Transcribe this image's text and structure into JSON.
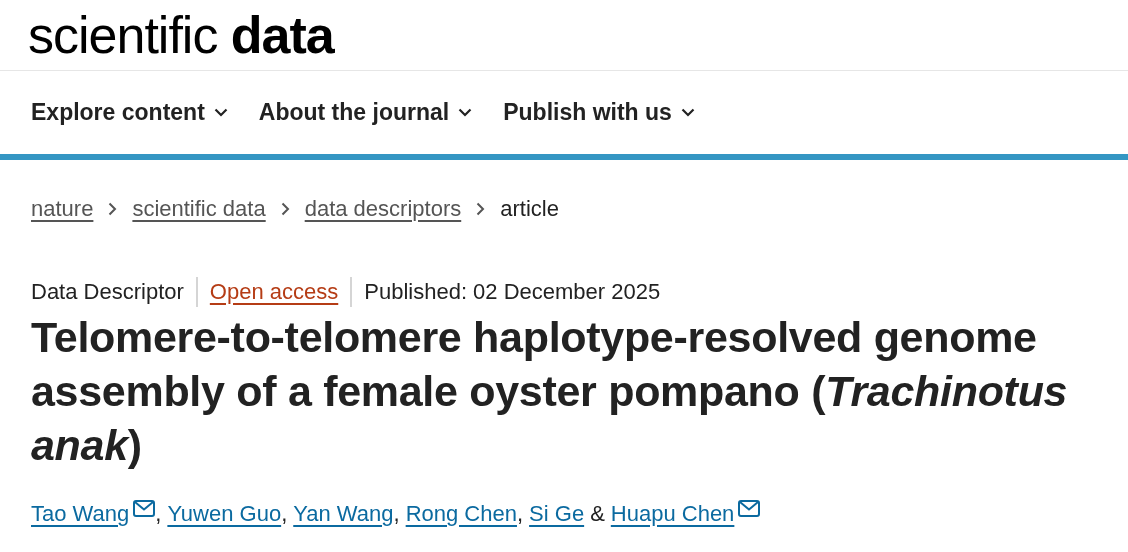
{
  "logo": "scientific **data**",
  "nav": [
    {
      "label": "Explore content"
    },
    {
      "label": "About the journal"
    },
    {
      "label": "Publish with us"
    }
  ],
  "breadcrumb": [
    {
      "label": "nature",
      "link": true
    },
    {
      "label": "scientific data",
      "link": true
    },
    {
      "label": "data descriptors",
      "link": true
    },
    {
      "label": "article",
      "link": false
    }
  ],
  "meta": {
    "type": "Data Descriptor",
    "access": "Open access",
    "published": "Published: 02 December 2025"
  },
  "title": "Telomere-to-telomere haplotype-resolved genome assembly of a female oyster pompano (*Trachinotus anak*)",
  "authors": [
    {
      "name": "Tao Wang",
      "email": true,
      "separator": ","
    },
    {
      "name": "Yuwen Guo",
      "email": false,
      "separator": ","
    },
    {
      "name": "Yan Wang",
      "email": false,
      "separator": ","
    },
    {
      "name": "Rong Chen",
      "email": false,
      "separator": ","
    },
    {
      "name": "Si Ge",
      "email": false,
      "separator": "&"
    },
    {
      "name": "Huapu Chen",
      "email": true
    }
  ]
}
